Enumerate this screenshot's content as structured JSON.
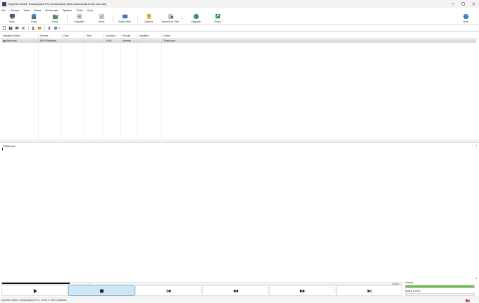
{
  "window": {
    "title": "Express Scribe Transcription Pro (Unlicensed) Non-commercial home use only"
  },
  "menu": [
    "File",
    "Control",
    "View",
    "Notes",
    "Bookmark",
    "Options",
    "Tools",
    "Help"
  ],
  "toolbar": [
    {
      "label": "Sync",
      "icon": "sync-icon"
    },
    {
      "label": "Load",
      "icon": "load-icon"
    },
    {
      "label": "Dock",
      "icon": "dock-icon"
    },
    {
      "label": "Dispatch",
      "icon": "dispatch-icon"
    },
    {
      "label": "Done",
      "icon": "done-icon"
    },
    {
      "label": "Scribe Mini",
      "icon": "scribe-mini-icon"
    },
    {
      "label": "Options",
      "icon": "options-icon"
    },
    {
      "label": "Speech-to-Text",
      "icon": "speech-to-text-icon"
    },
    {
      "label": "Upgrade",
      "icon": "upgrade-icon"
    },
    {
      "label": "Share",
      "icon": "share-icon"
    },
    {
      "label": "Help",
      "icon": "help-icon"
    }
  ],
  "table": {
    "columns": [
      "Dictation Name",
      "Sender",
      "Date",
      "Time",
      "Duration",
      "Priority",
      "Deadline",
      "Notes"
    ],
    "rows": [
      {
        "name": "Welcome",
        "sender": "NCH Software",
        "date": "",
        "time": "",
        "duration": "0:08",
        "priority": "Normal",
        "deadline": "",
        "notes": "Thank you"
      }
    ]
  },
  "notes_editor": {
    "text": "Thank you"
  },
  "playback": {
    "position": "0:00.0",
    "progress_fraction": 0.17,
    "volume_label": "Volume",
    "volume_fraction": 1.0,
    "speed_label": "Speed (100%)",
    "speed_fraction": 0.5
  },
  "status": {
    "text": "Express Scribe Transcription Pro v 14.00 © NCH Software"
  },
  "colors": {
    "accent_active": "#cfe6f7",
    "volume": "#6fbf4a",
    "progress": "#101010"
  }
}
